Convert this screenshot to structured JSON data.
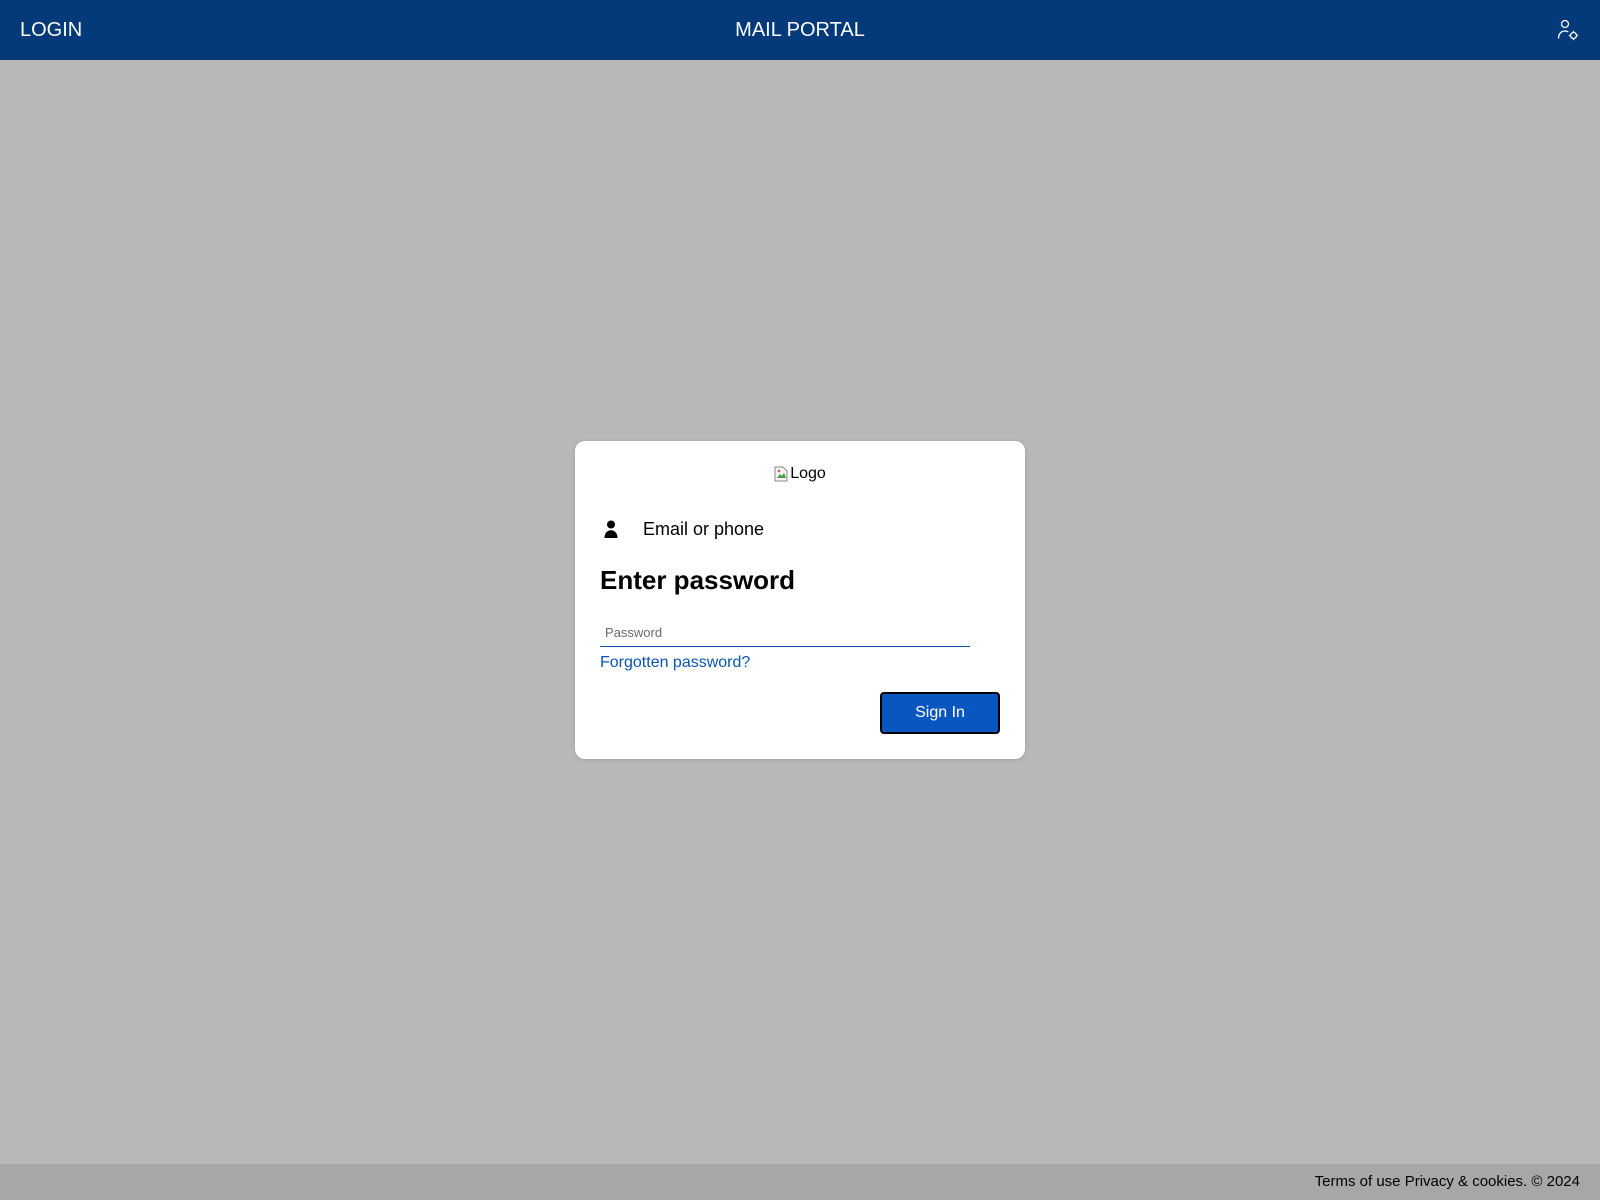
{
  "topbar": {
    "left_label": "LOGIN",
    "title": "MAIL PORTAL",
    "right_icon": "user-settings-icon",
    "background": "#043a7a"
  },
  "card": {
    "logo_alt": "Logo",
    "logo_icon": "broken-image-icon",
    "identity_icon": "person-icon",
    "identity_text": "Email or phone",
    "heading": "Enter password",
    "password_placeholder": "Password",
    "password_value": "",
    "forgot_label": "Forgotten password?",
    "signin_label": "Sign In",
    "accent": "#0a56c0"
  },
  "footer": {
    "terms_label": "Terms of use",
    "privacy_label": "Privacy & cookies.",
    "copyright": "© 2024"
  },
  "page": {
    "background": "#b8b8b8"
  }
}
